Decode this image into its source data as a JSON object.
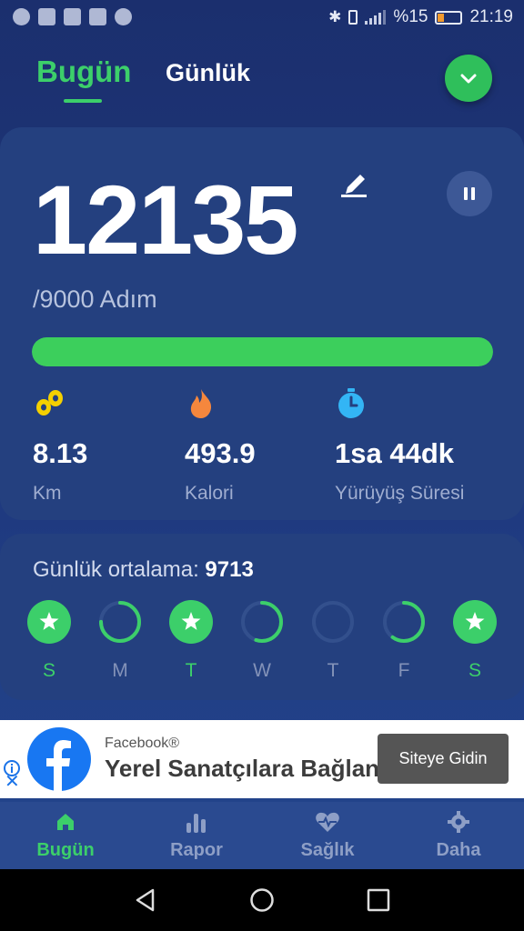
{
  "status_bar": {
    "battery_percent": "%15",
    "time": "21:19",
    "left_icons": [
      "spotify-icon",
      "news-icon",
      "cloud-icon",
      "wifi-signal-icon",
      "whatsapp-icon"
    ],
    "right_icons": [
      "bluetooth-icon",
      "vibrate-icon",
      "hplus-icon",
      "signal-icon",
      "battery-icon"
    ]
  },
  "tabs": {
    "today": "Bugün",
    "daily": "Günlük",
    "active": "today"
  },
  "steps": {
    "count": "12135",
    "goal": "/9000 Adım",
    "progress_fraction": 1.0
  },
  "stats": {
    "distance": {
      "value": "8.13",
      "label": "Km",
      "icon": "footprints-icon"
    },
    "calories": {
      "value": "493.9",
      "label": "Kalori",
      "icon": "flame-icon"
    },
    "duration": {
      "value": "1sa 44dk",
      "label": "Yürüyüş Süresi",
      "icon": "stopwatch-icon"
    }
  },
  "weekly": {
    "avg_label": "Günlük ortalama: ",
    "avg_value": "9713",
    "days": [
      {
        "label": "S",
        "progress": 1.0
      },
      {
        "label": "M",
        "progress": 0.75
      },
      {
        "label": "T",
        "progress": 1.0
      },
      {
        "label": "W",
        "progress": 0.55
      },
      {
        "label": "T",
        "progress": 0.0
      },
      {
        "label": "F",
        "progress": 0.6
      },
      {
        "label": "S",
        "progress": 1.0
      }
    ]
  },
  "ad": {
    "brand": "Facebook®",
    "title": "Yerel Sanatçılara Bağlan",
    "cta": "Siteye Gidin"
  },
  "bottom_nav": [
    {
      "label": "Bugün",
      "icon": "home-icon",
      "active": true
    },
    {
      "label": "Rapor",
      "icon": "bar-chart-icon",
      "active": false
    },
    {
      "label": "Sağlık",
      "icon": "heart-pulse-icon",
      "active": false
    },
    {
      "label": "Daha",
      "icon": "gear-icon",
      "active": false
    }
  ],
  "colors": {
    "accent": "#3ccf6a",
    "background": "#1f3a80",
    "card": "#24407f",
    "ring_track": "#33508d",
    "distance_icon": "#f4d000",
    "calorie_icon": "#f5873d",
    "time_icon": "#33b5f5"
  }
}
